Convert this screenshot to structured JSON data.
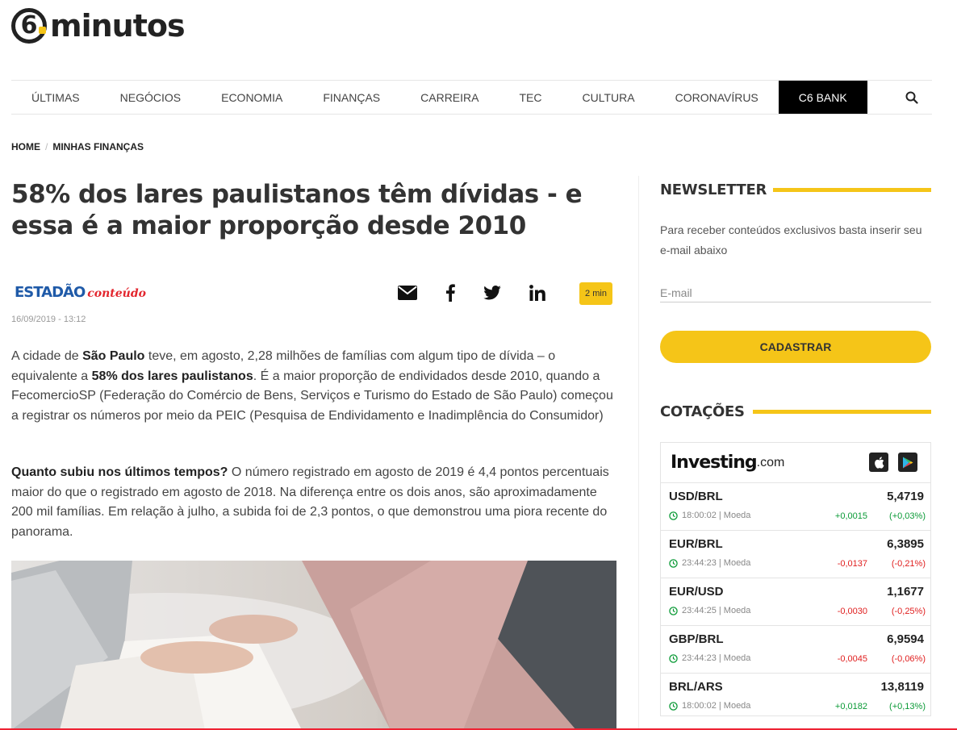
{
  "brand": {
    "logo_digit": "6",
    "logo_text": "minutos"
  },
  "nav": {
    "items": [
      "ÚLTIMAS",
      "NEGÓCIOS",
      "ECONOMIA",
      "FINANÇAS",
      "CARREIRA",
      "TEC",
      "CULTURA",
      "CORONAVÍRUS"
    ],
    "highlight": "C6 BANK"
  },
  "breadcrumb": {
    "home": "HOME",
    "separator": "/",
    "section": "MINHAS FINANÇAS"
  },
  "article": {
    "title": "58% dos lares paulistanos têm dívidas - e essa é a maior proporção desde 2010",
    "source_main": "ESTADÃO",
    "source_sub": "conteúdo",
    "date": "16/09/2019 - 13:12",
    "read_time": "2 min",
    "share_icons": [
      "email-icon",
      "facebook-icon",
      "twitter-icon",
      "linkedin-icon"
    ],
    "p1": {
      "t1": "A cidade de ",
      "b1": "São Paulo",
      "t2": " teve, em agosto, 2,28 milhões de famílias com algum tipo de dívida – o equivalente a ",
      "b2": "58% dos lares paulistanos",
      "t3": ". É a maior proporção de endividados desde 2010, quando a FecomercioSP (Federação do Comércio de Bens, Serviços e Turismo do Estado de São Paulo) começou a registrar os números por meio da PEIC (Pesquisa de Endividamento e Inadimplência do Consumidor)"
    },
    "p2": {
      "b1": "Quanto subiu nos últimos tempos?",
      "t1": " O número registrado em agosto de 2019 é 4,4 pontos percentuais maior do que o registrado em agosto de 2018. Na diferença entre os dois anos, são aproximadamente 200 mil famílias. Em relação à julho, a subida foi de 2,3 pontos, o que demonstrou uma piora recente do panorama."
    }
  },
  "newsletter": {
    "heading": "NEWSLETTER",
    "text": "Para receber conteúdos exclusivos basta inserir seu e-mail abaixo",
    "email_placeholder": "E-mail",
    "button": "CADASTRAR"
  },
  "quotes": {
    "heading": "COTAÇÕES",
    "brand": "Investing",
    "brand_suffix": ".com",
    "colors": {
      "up": "#0a9a36",
      "down": "#e01e1e",
      "accent": "#f5c518"
    },
    "rows": [
      {
        "pair": "USD/BRL",
        "price": "5,4719",
        "time": "18:00:02 | Moeda",
        "change": "+0,0015",
        "pct": "(+0,03%)",
        "dir": "up"
      },
      {
        "pair": "EUR/BRL",
        "price": "6,3895",
        "time": "23:44:23 | Moeda",
        "change": "-0,0137",
        "pct": "(-0,21%)",
        "dir": "down"
      },
      {
        "pair": "EUR/USD",
        "price": "1,1677",
        "time": "23:44:25 | Moeda",
        "change": "-0,0030",
        "pct": "(-0,25%)",
        "dir": "down"
      },
      {
        "pair": "GBP/BRL",
        "price": "6,9594",
        "time": "23:44:23 | Moeda",
        "change": "-0,0045",
        "pct": "(-0,06%)",
        "dir": "down"
      },
      {
        "pair": "BRL/ARS",
        "price": "13,8119",
        "time": "18:00:02 | Moeda",
        "change": "+0,0182",
        "pct": "(+0,13%)",
        "dir": "up"
      }
    ]
  }
}
